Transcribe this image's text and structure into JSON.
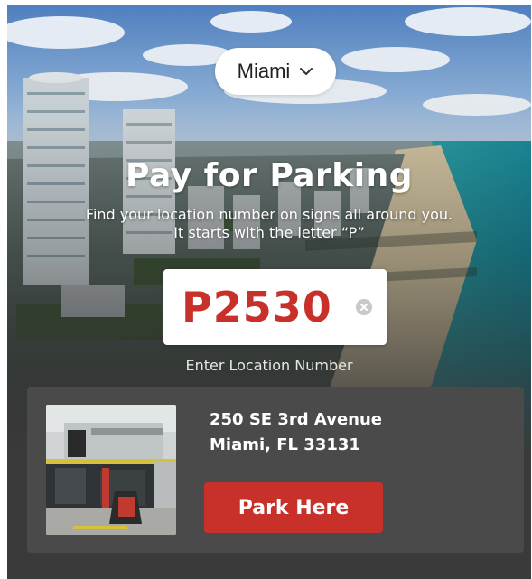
{
  "city_selector": {
    "city": "Miami",
    "icon": "chevron-down-icon"
  },
  "header": {
    "title": "Pay for Parking",
    "instructions_line1": "Find your location number on signs all around you.",
    "instructions_line2": "It starts with the letter “P”"
  },
  "location_input": {
    "value": "P2530",
    "label": "Enter Location Number",
    "clear_icon": "clear-icon"
  },
  "location_card": {
    "photo": "parking-garage-photo",
    "address_line1": "250 SE 3rd Avenue",
    "address_line2": "Miami, FL 33131",
    "park_button_label": "Park Here"
  },
  "colors": {
    "accent_red": "#c8302a",
    "card_background": "#4a4a4a",
    "page_background": "#3a3a3a"
  }
}
